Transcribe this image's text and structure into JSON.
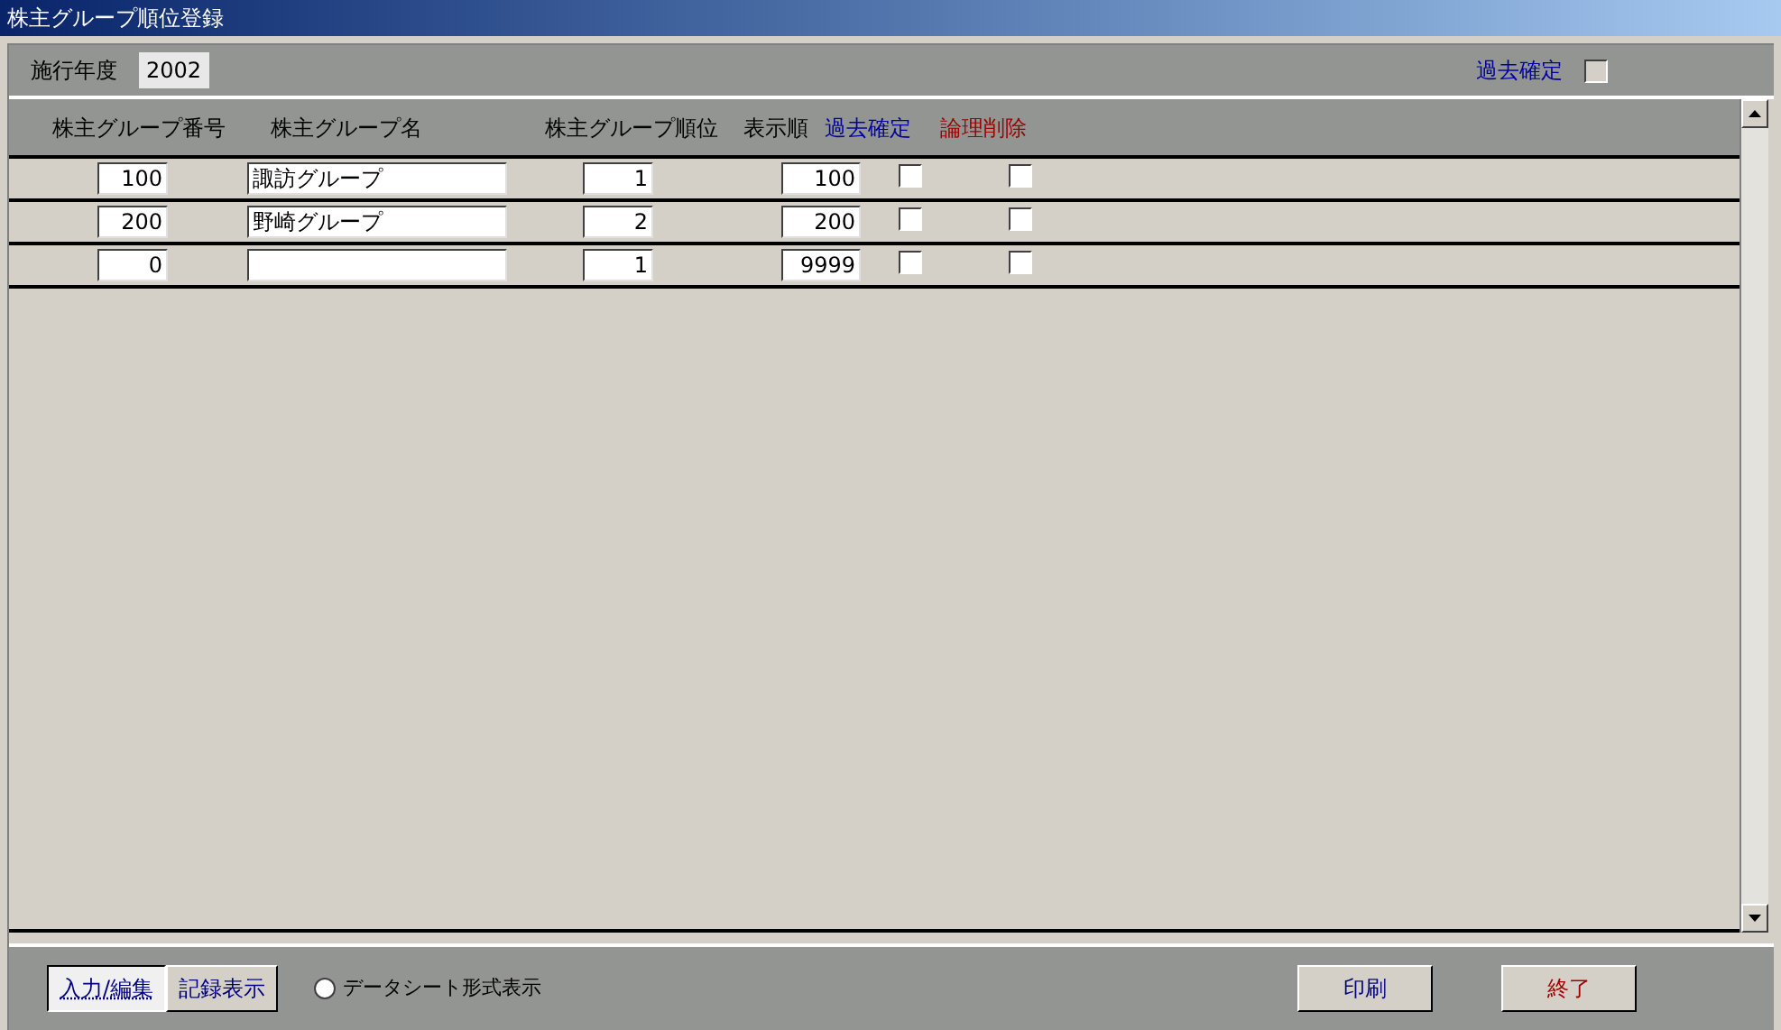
{
  "window": {
    "title": "株主グループ順位登録"
  },
  "header": {
    "year_label": "施行年度",
    "year_value": "2002",
    "past_confirmed_label": "過去確定",
    "past_confirmed_checked": false
  },
  "table": {
    "columns": [
      {
        "label": "株主グループ番号",
        "kind": "plain"
      },
      {
        "label": "株主グループ名",
        "kind": "plain"
      },
      {
        "label": "株主グループ順位",
        "kind": "plain"
      },
      {
        "label": "表示順",
        "kind": "plain"
      },
      {
        "label": "過去確定",
        "kind": "blue"
      },
      {
        "label": "論理削除",
        "kind": "red"
      }
    ],
    "rows": [
      {
        "number": "100",
        "name": "諏訪グループ",
        "rank": "1",
        "order": "100",
        "past_confirmed": false,
        "deleted": false
      },
      {
        "number": "200",
        "name": "野崎グループ",
        "rank": "2",
        "order": "200",
        "past_confirmed": false,
        "deleted": false
      },
      {
        "number": "0",
        "rank": "1",
        "order": "9999",
        "past_confirmed": false,
        "deleted": false
      }
    ]
  },
  "footer": {
    "view_buttons": [
      {
        "label": "入力/編集",
        "selected": true
      },
      {
        "label": "記録表示",
        "selected": false
      }
    ],
    "datasheet_option": {
      "label": "データシート形式表示",
      "selected": false
    },
    "buttons": [
      {
        "label": "印刷",
        "kind": "normal"
      },
      {
        "label": "終了",
        "kind": "exit"
      }
    ]
  }
}
